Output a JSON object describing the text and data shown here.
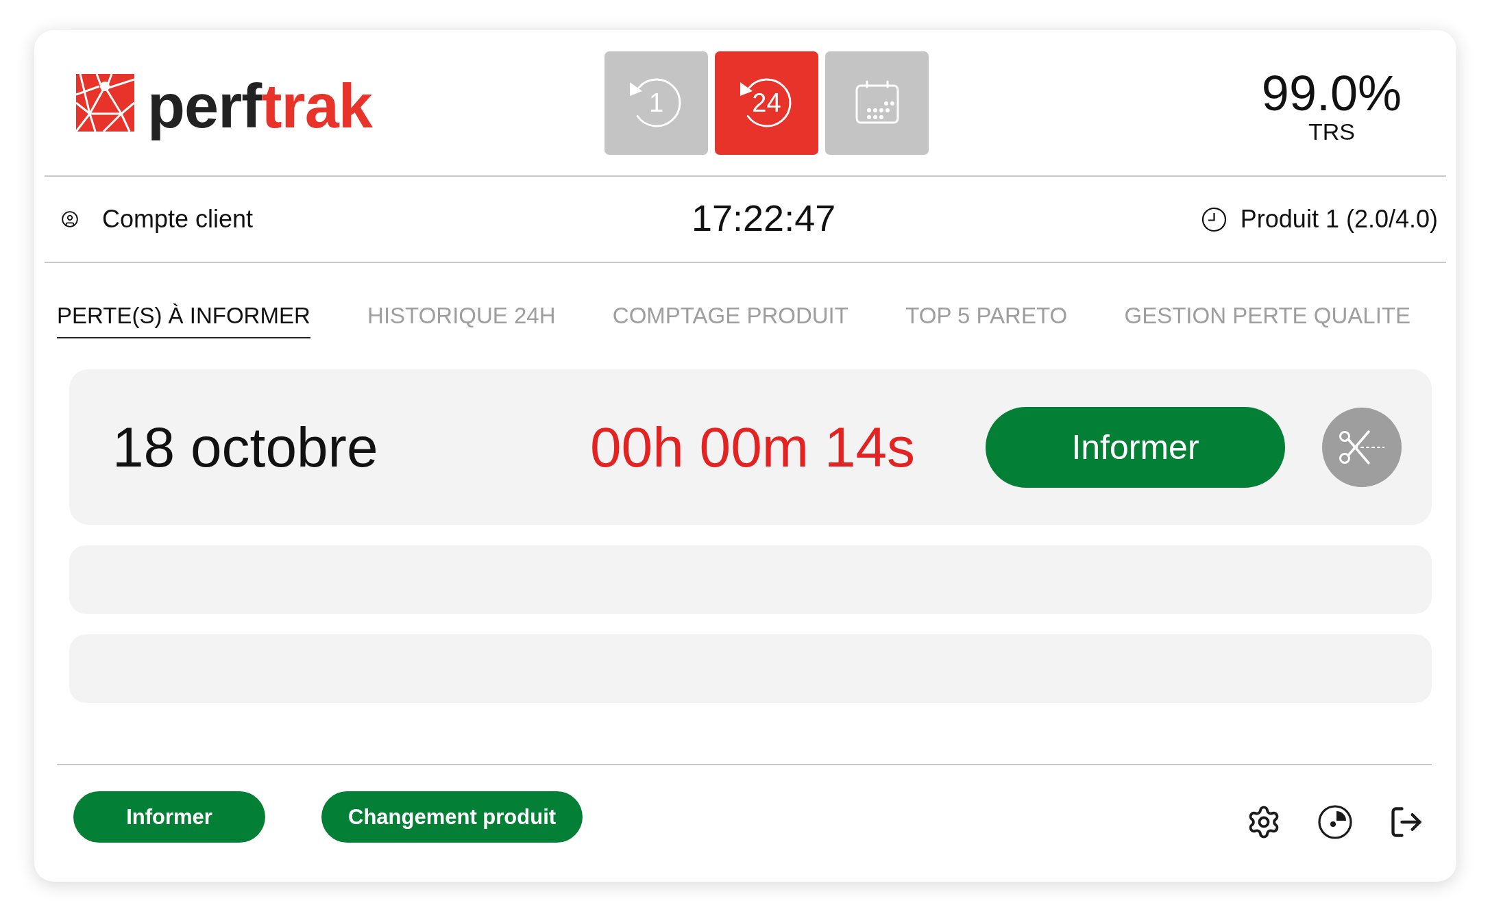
{
  "header": {
    "logo": {
      "dark_part": "perf",
      "accent_part": "trak"
    },
    "period_buttons": [
      {
        "kind": "history",
        "label": "1",
        "selected": false
      },
      {
        "kind": "history",
        "label": "24",
        "selected": true
      },
      {
        "kind": "calendar",
        "selected": false
      }
    ],
    "trs": {
      "value": "99.0%",
      "label": "TRS"
    }
  },
  "info_bar": {
    "account": "Compte client",
    "time": "17:22:47",
    "product": "Produit 1 (2.0/4.0)"
  },
  "tabs": [
    {
      "label": "PERTE(S) À INFORMER",
      "selected": true
    },
    {
      "label": "HISTORIQUE 24H",
      "selected": false
    },
    {
      "label": "COMPTAGE PRODUIT",
      "selected": false
    },
    {
      "label": "TOP 5 PARETO",
      "selected": false
    },
    {
      "label": "GESTION PERTE QUALITE",
      "selected": false
    }
  ],
  "losses": [
    {
      "kind": "loss",
      "date": "18 octobre",
      "duration": "00h 00m 14s",
      "action": "Informer"
    },
    {
      "kind": "empty"
    },
    {
      "kind": "empty"
    }
  ],
  "footer": {
    "buttons": [
      "Informer",
      "Changement produit"
    ]
  }
}
